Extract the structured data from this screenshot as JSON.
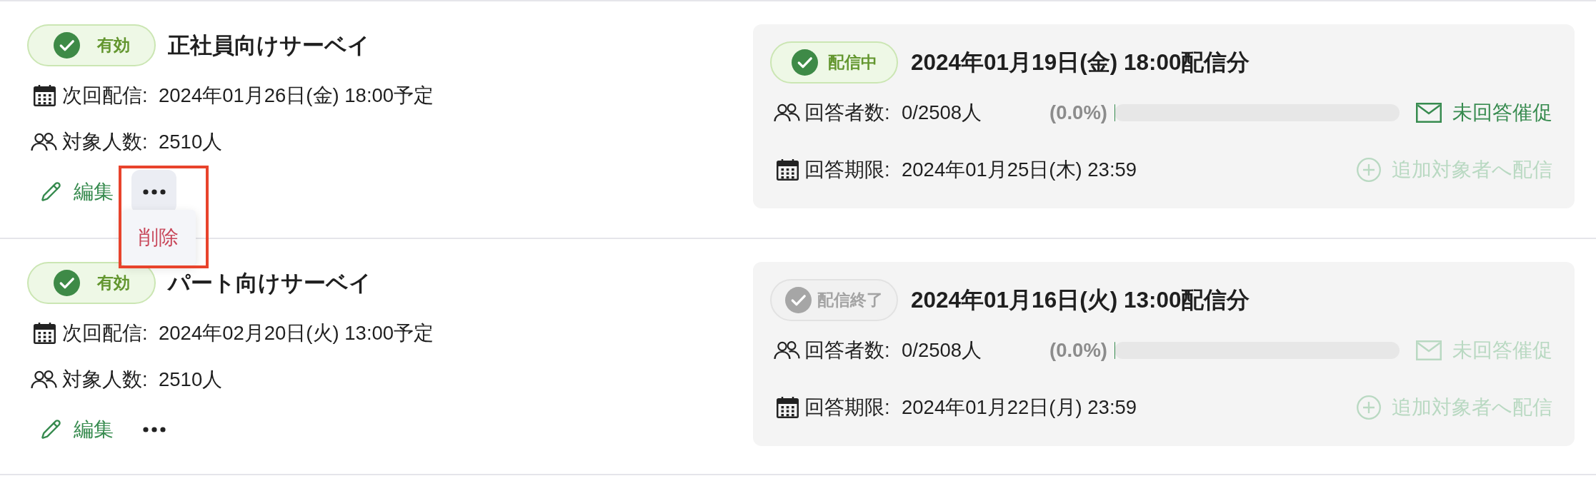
{
  "surveys": [
    {
      "status": {
        "label": "有効",
        "kind": "active"
      },
      "title": "正社員向けサーベイ",
      "next_delivery": {
        "label": "次回配信:",
        "value": "2024年01月26日(金) 18:00予定"
      },
      "target_count": {
        "label": "対象人数:",
        "value": "2510人"
      },
      "edit_button": "編集",
      "more_menu": {
        "open": true,
        "highlighted": true,
        "items": [
          {
            "label": "削除"
          }
        ]
      },
      "latest_delivery": {
        "status": {
          "label": "配信中",
          "kind": "delivering"
        },
        "title": "2024年01月19日(金) 18:00配信分",
        "respondents": {
          "label": "回答者数:",
          "value": "0/2508人",
          "percent": "(0.0%)",
          "level": 0
        },
        "deadline": {
          "label": "回答期限:",
          "value": "2024年01月25日(木) 23:59"
        },
        "remind_button": {
          "label": "未回答催促",
          "disabled": false
        },
        "add_targets_button": {
          "label": "追加対象者へ配信",
          "disabled": true
        }
      }
    },
    {
      "status": {
        "label": "有効",
        "kind": "active"
      },
      "title": "パート向けサーベイ",
      "next_delivery": {
        "label": "次回配信:",
        "value": "2024年02月20日(火) 13:00予定"
      },
      "target_count": {
        "label": "対象人数:",
        "value": "2510人"
      },
      "edit_button": "編集",
      "more_menu": {
        "open": false,
        "highlighted": false
      },
      "latest_delivery": {
        "status": {
          "label": "配信終了",
          "kind": "ended"
        },
        "title": "2024年01月16日(火) 13:00配信分",
        "respondents": {
          "label": "回答者数:",
          "value": "0/2508人",
          "percent": "(0.0%)",
          "level": 0
        },
        "deadline": {
          "label": "回答期限:",
          "value": "2024年01月22日(月) 23:59"
        },
        "remind_button": {
          "label": "未回答催促",
          "disabled": true
        },
        "add_targets_button": {
          "label": "追加対象者へ配信",
          "disabled": true
        }
      }
    }
  ]
}
